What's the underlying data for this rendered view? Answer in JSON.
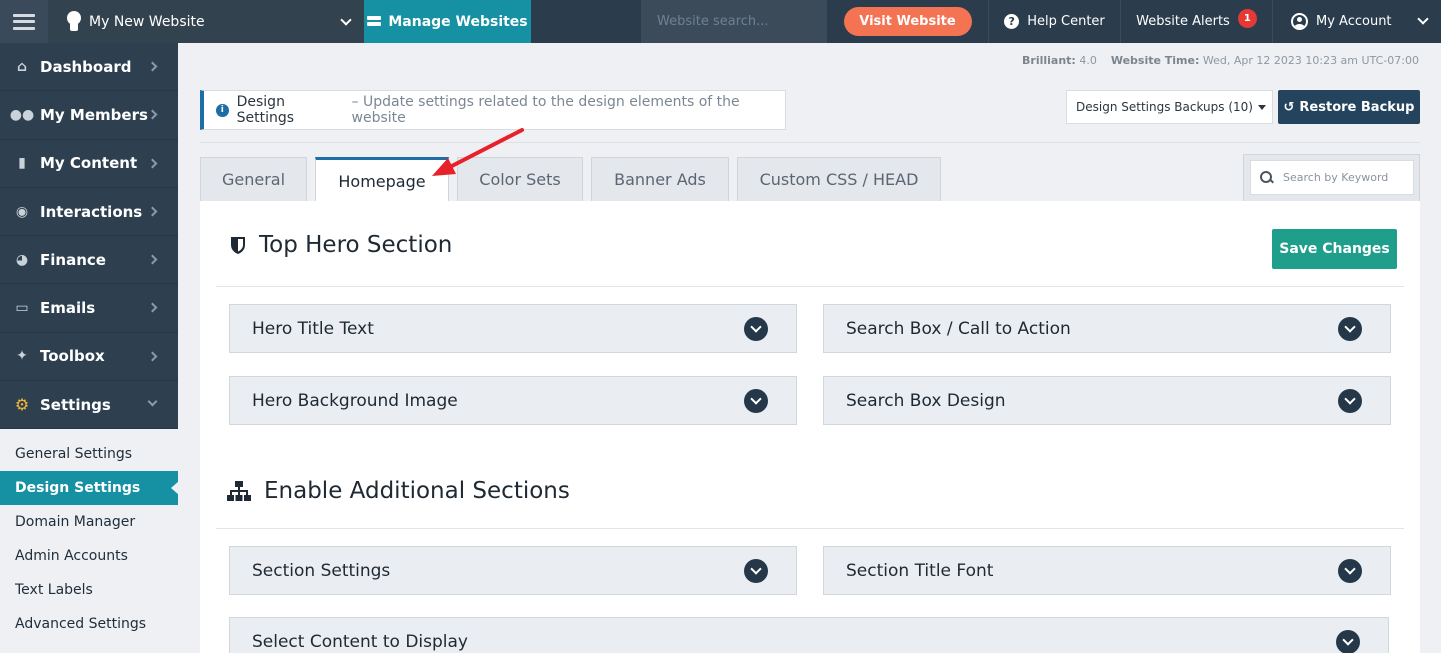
{
  "topbar": {
    "site_name": "My New Website",
    "manage_label": "Manage Websites",
    "search_placeholder": "Website search...",
    "visit_label": "Visit Website",
    "help_label": "Help Center",
    "alerts_label": "Website Alerts",
    "alerts_count": "1",
    "account_label": "My Account"
  },
  "sidebar": {
    "items": [
      {
        "label": "Dashboard",
        "icon": "home-icon"
      },
      {
        "label": "My Members",
        "icon": "users-icon"
      },
      {
        "label": "My Content",
        "icon": "folder-icon"
      },
      {
        "label": "Interactions",
        "icon": "comments-icon"
      },
      {
        "label": "Finance",
        "icon": "pie-chart-icon"
      },
      {
        "label": "Emails",
        "icon": "inbox-icon"
      },
      {
        "label": "Toolbox",
        "icon": "wrench-icon"
      },
      {
        "label": "Settings",
        "icon": "gear-icon"
      }
    ],
    "sub_items": [
      "General Settings",
      "Design Settings",
      "Domain Manager",
      "Admin Accounts",
      "Text Labels",
      "Advanced Settings"
    ]
  },
  "meta": {
    "version_label": "Brilliant:",
    "version_value": "4.0",
    "time_label": "Website Time:",
    "time_value": "Wed, Apr 12 2023 10:23 am UTC-07:00"
  },
  "header": {
    "title": "Design Settings",
    "description": "– Update settings related to the design elements of the website",
    "backups_label": "Design Settings Backups (10)",
    "restore_label": "Restore Backup"
  },
  "tabs": [
    "General",
    "Homepage",
    "Color Sets",
    "Banner Ads",
    "Custom CSS / HEAD"
  ],
  "keyword_placeholder": "Search by Keyword",
  "sections": {
    "hero_title": "Top Hero Section",
    "save_label": "Save Changes",
    "hero_items": [
      "Hero Title Text",
      "Search Box / Call to Action",
      "Hero Background Image",
      "Search Box Design"
    ],
    "additional_title": "Enable Additional Sections",
    "additional_items": [
      "Section Settings",
      "Section Title Font",
      "Select Content to Display"
    ]
  },
  "colors": {
    "topbar": "#2b3c4c",
    "accent": "#1591a3",
    "visit": "#f47353",
    "save": "#1f9e8c",
    "annotation_arrow": "#e8202a"
  }
}
